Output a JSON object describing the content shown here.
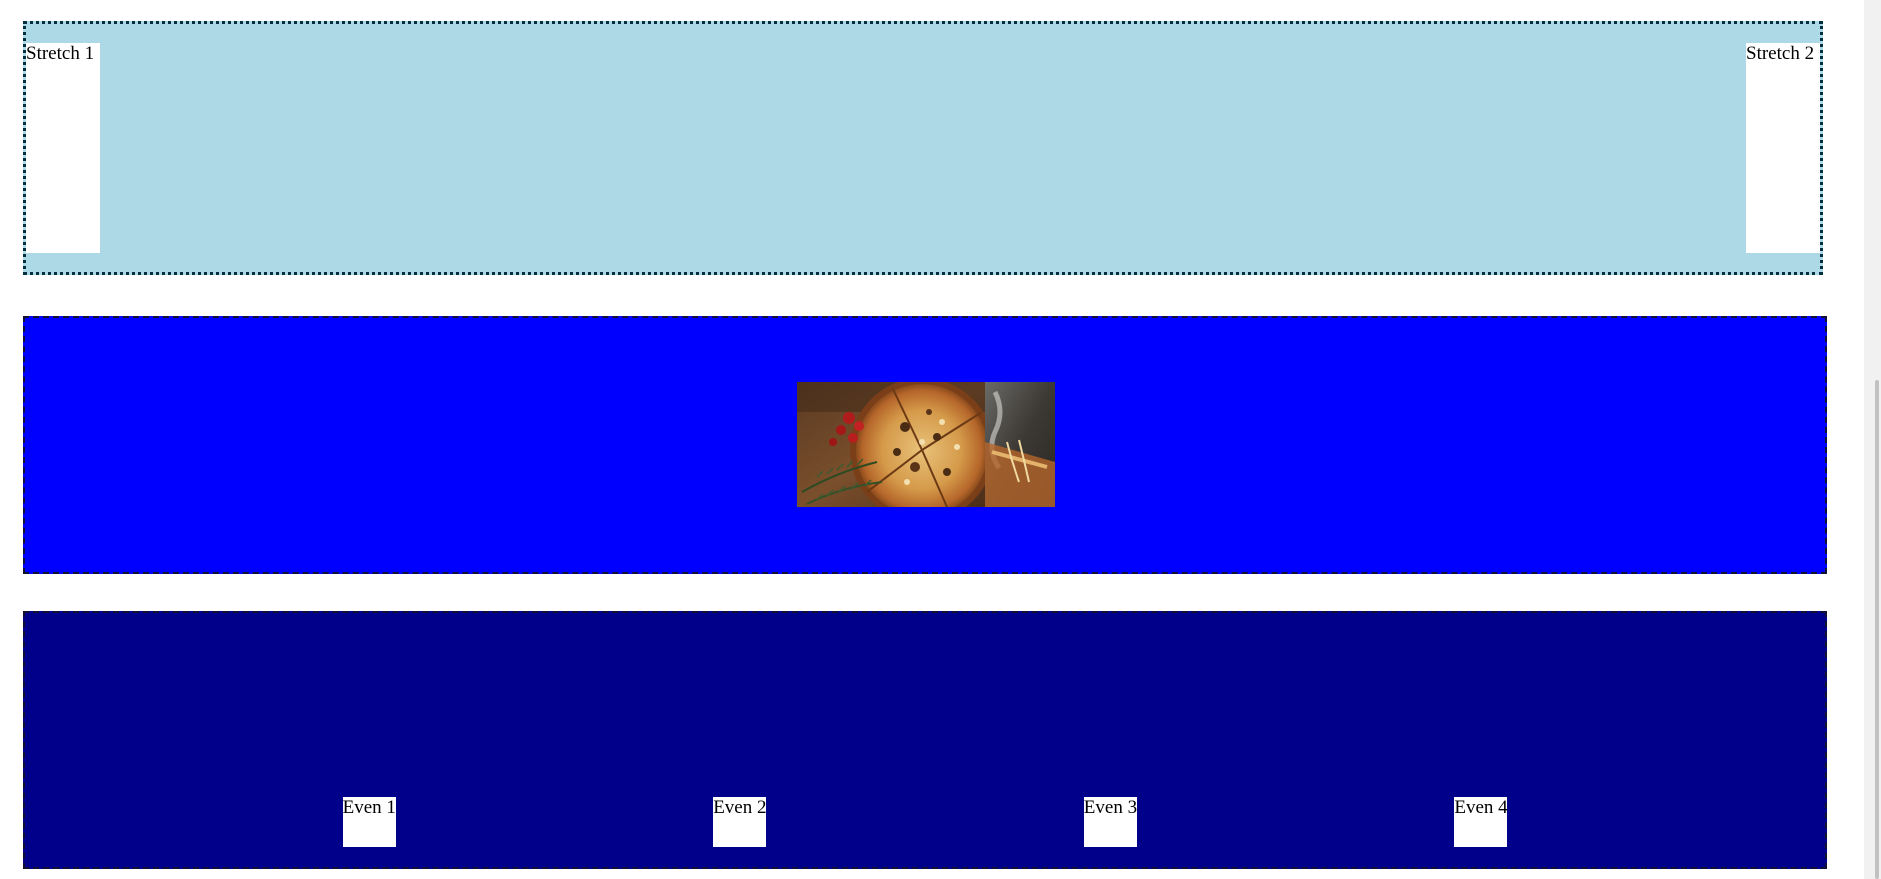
{
  "stretch_section": {
    "items": [
      {
        "label": "Stretch 1"
      },
      {
        "label": "Stretch 2"
      }
    ],
    "background": "#add8e6"
  },
  "center_section": {
    "background": "#0000ff",
    "image_alt": "pizza-photo"
  },
  "even_section": {
    "items": [
      {
        "label": "Even 1"
      },
      {
        "label": "Even 2"
      },
      {
        "label": "Even 3"
      },
      {
        "label": "Even 4"
      }
    ],
    "background": "#00008b"
  }
}
